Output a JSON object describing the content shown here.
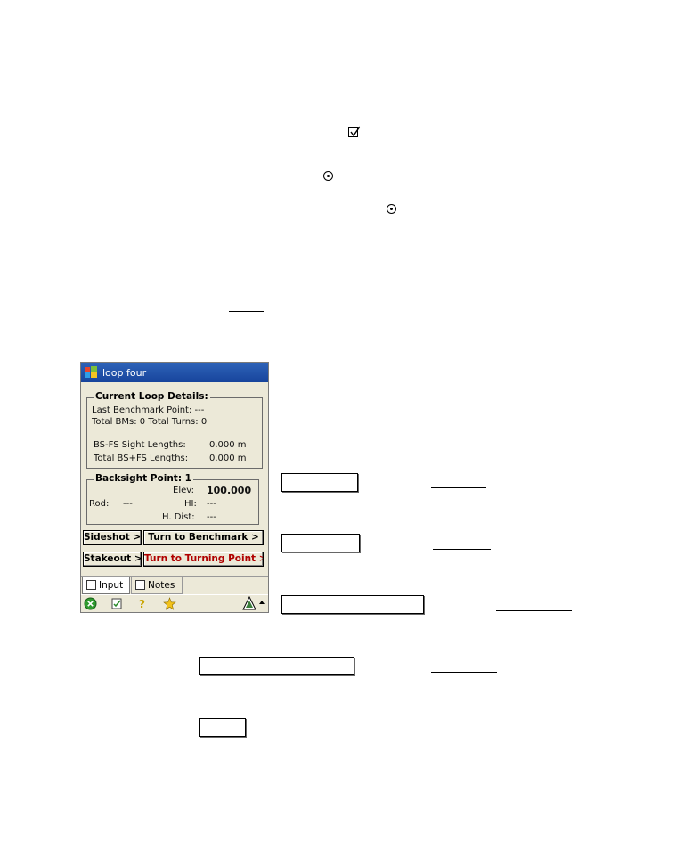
{
  "window": {
    "title": "loop four"
  },
  "current_loop": {
    "heading": "Current Loop Details:",
    "last_benchmark": "Last Benchmark Point: ---",
    "totals": "Total BMs: 0   Total Turns: 0",
    "bs_fs_label": "BS-FS Sight Lengths:",
    "bs_fs_value": "0.000 m",
    "total_label": "Total BS+FS Lengths:",
    "total_value": "0.000 m"
  },
  "backsight": {
    "heading": "Backsight Point: 1",
    "elev_label": "Elev:",
    "elev_value": "100.000",
    "rod_label": "Rod:",
    "rod_value": "---",
    "hi_label": "HI:",
    "hi_value": "---",
    "hdist_label": "H. Dist:",
    "hdist_value": "---"
  },
  "buttons": {
    "sideshot": "Sideshot >",
    "turn_benchmark": "Turn to Benchmark >",
    "stakeout": "Stakeout >",
    "turn_turning": "Turn to Turning Point >"
  },
  "tabs": {
    "input": "Input",
    "notes": "Notes"
  },
  "colors": {
    "titlebar": "#17449c",
    "warning_text": "#b00000"
  },
  "icons": [
    "windows-flag-icon",
    "close-icon",
    "checklist-icon",
    "help-icon",
    "favorites-icon",
    "level-instrument-icon",
    "arrow-up-icon"
  ]
}
